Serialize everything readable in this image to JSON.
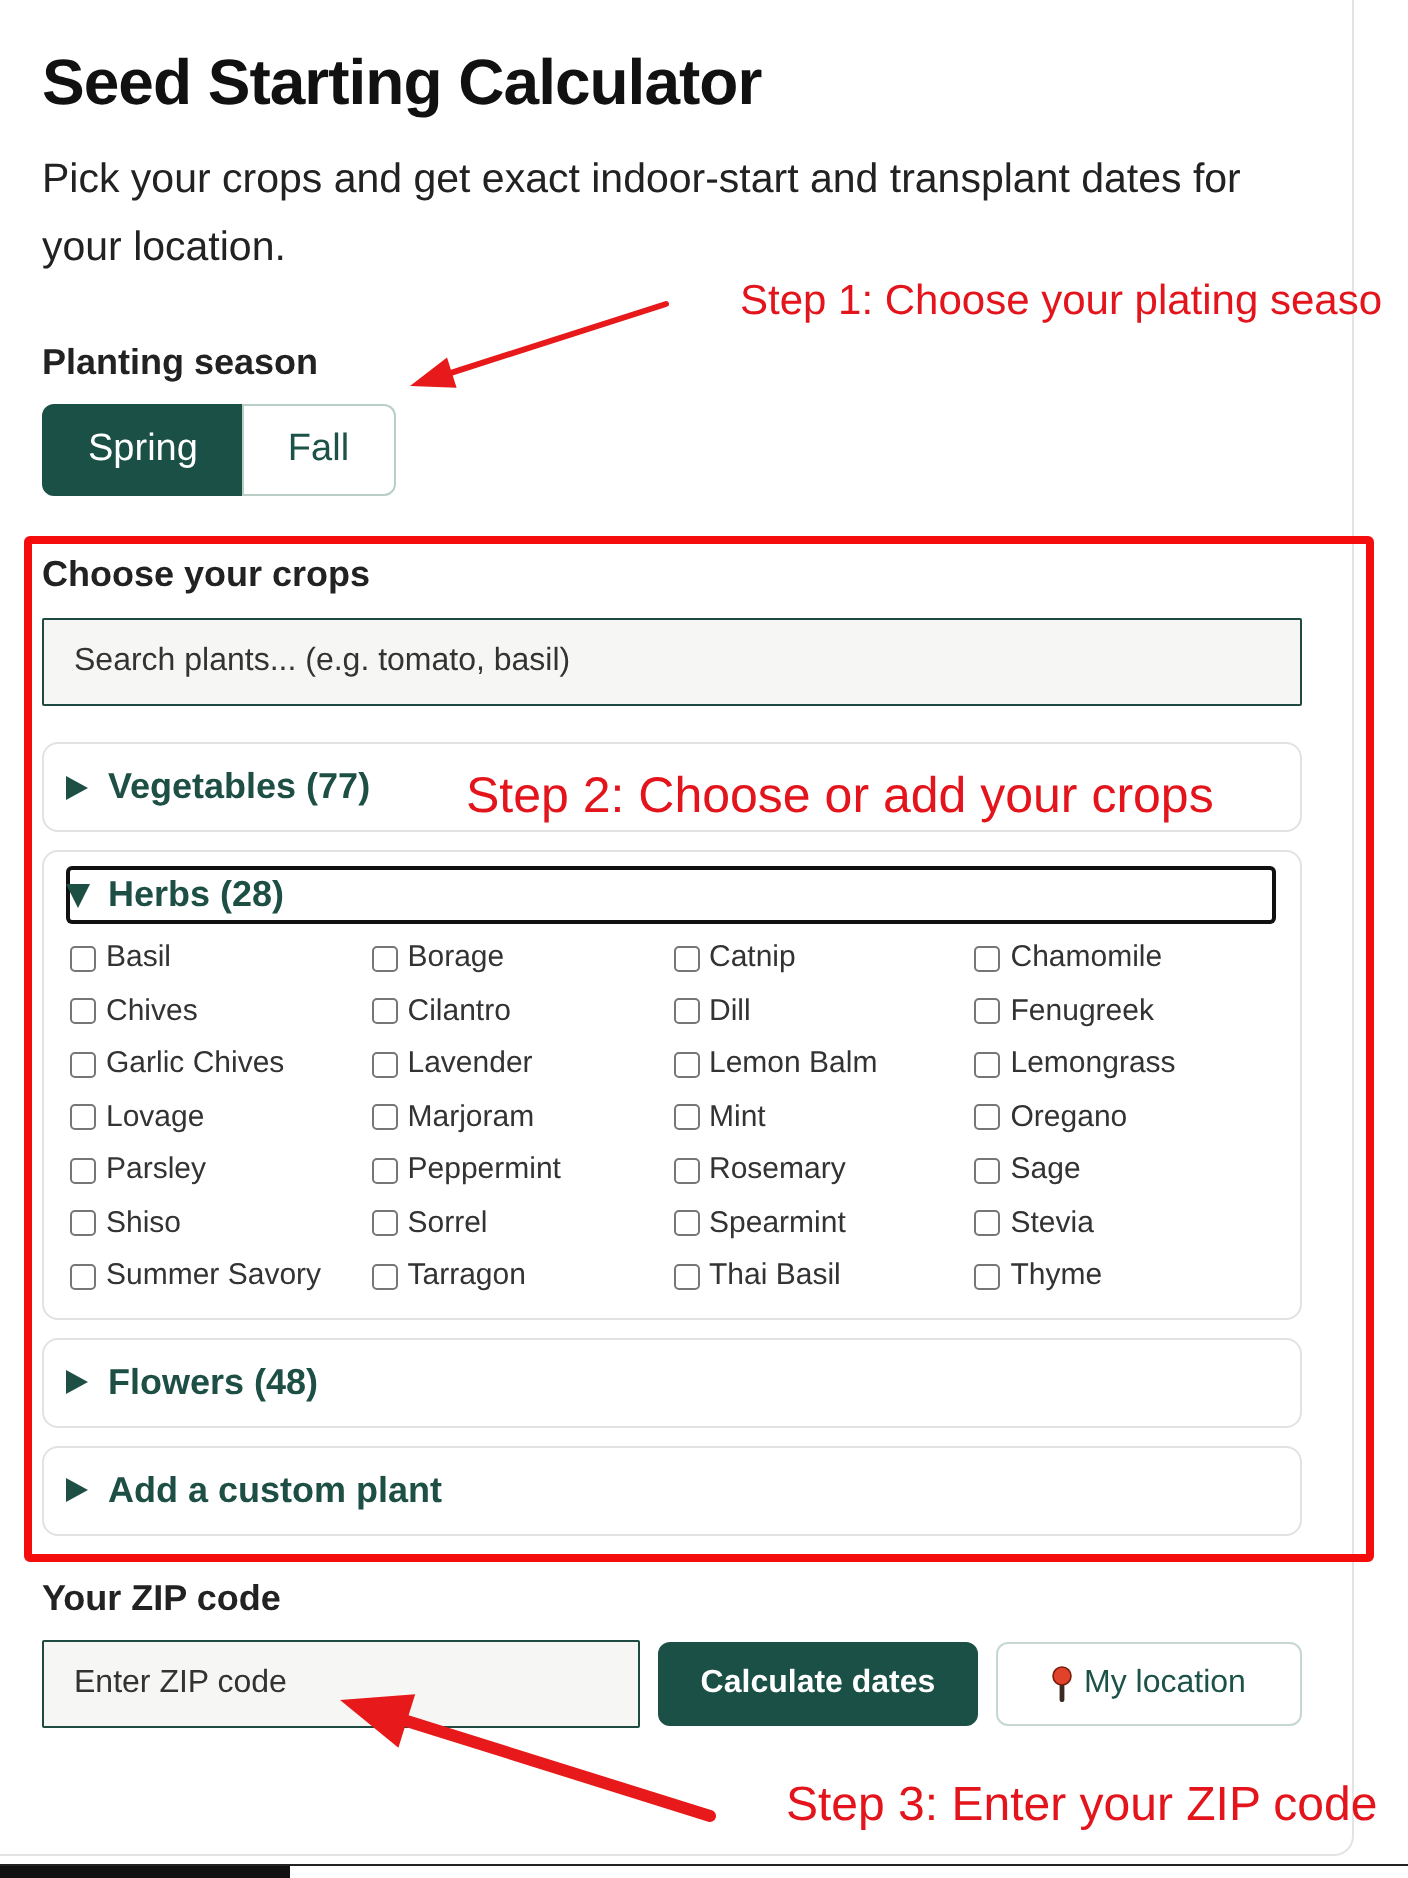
{
  "page": {
    "title": "Seed Starting Calculator",
    "description": "Pick your crops and get exact indoor-start and transplant dates for your location."
  },
  "season": {
    "label": "Planting season",
    "options": [
      {
        "label": "Spring",
        "selected": true
      },
      {
        "label": "Fall",
        "selected": false
      }
    ]
  },
  "crops": {
    "label": "Choose your crops",
    "search": {
      "placeholder": "Search plants... (e.g. tomato, basil)"
    },
    "groups": [
      {
        "title": "Vegetables (77)",
        "expanded": false,
        "focused": false
      },
      {
        "title": "Herbs (28)",
        "expanded": true,
        "focused": true,
        "plants": [
          {
            "name": "Basil",
            "checked": false
          },
          {
            "name": "Borage",
            "checked": false
          },
          {
            "name": "Catnip",
            "checked": false
          },
          {
            "name": "Chamomile",
            "checked": false
          },
          {
            "name": "Chives",
            "checked": false
          },
          {
            "name": "Cilantro",
            "checked": false
          },
          {
            "name": "Dill",
            "checked": false
          },
          {
            "name": "Fenugreek",
            "checked": false
          },
          {
            "name": "Garlic Chives",
            "checked": false
          },
          {
            "name": "Lavender",
            "checked": false
          },
          {
            "name": "Lemon Balm",
            "checked": false
          },
          {
            "name": "Lemongrass",
            "checked": false
          },
          {
            "name": "Lovage",
            "checked": false
          },
          {
            "name": "Marjoram",
            "checked": false
          },
          {
            "name": "Mint",
            "checked": false
          },
          {
            "name": "Oregano",
            "checked": false
          },
          {
            "name": "Parsley",
            "checked": false
          },
          {
            "name": "Peppermint",
            "checked": false
          },
          {
            "name": "Rosemary",
            "checked": false
          },
          {
            "name": "Sage",
            "checked": false
          },
          {
            "name": "Shiso",
            "checked": false
          },
          {
            "name": "Sorrel",
            "checked": false
          },
          {
            "name": "Spearmint",
            "checked": false
          },
          {
            "name": "Stevia",
            "checked": false
          },
          {
            "name": "Summer Savory",
            "checked": false
          },
          {
            "name": "Tarragon",
            "checked": false
          },
          {
            "name": "Thai Basil",
            "checked": false
          },
          {
            "name": "Thyme",
            "checked": false
          }
        ]
      },
      {
        "title": "Flowers (48)",
        "expanded": false,
        "focused": false
      },
      {
        "title": "Add a custom plant",
        "expanded": false,
        "focused": false
      }
    ]
  },
  "zip": {
    "label": "Your ZIP code",
    "placeholder": "Enter ZIP code"
  },
  "buttons": [
    {
      "label": "Calculate dates",
      "kind": "primary"
    },
    {
      "label": "My location",
      "kind": "location"
    }
  ],
  "annotations": [
    {
      "kind": "arrow",
      "text": "Step 1: Choose your plating seaso"
    },
    {
      "kind": "box",
      "text": "Step 2: Choose or add your crops"
    },
    {
      "kind": "arrow",
      "text": "Step 3: Enter your ZIP code"
    }
  ]
}
